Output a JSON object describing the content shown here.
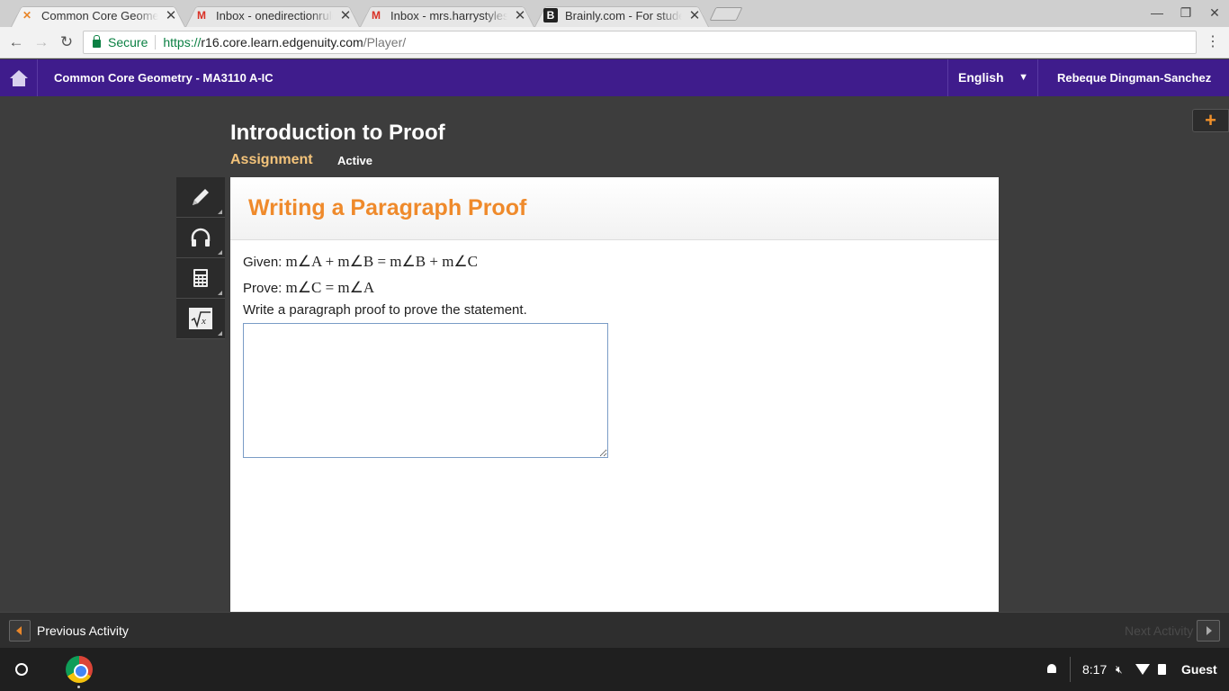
{
  "browser": {
    "tabs": [
      {
        "title": "Common Core Geometry",
        "favicon": "edgenuity-x-icon",
        "active": true
      },
      {
        "title": "Inbox - onedirectionrules",
        "favicon": "gmail-icon",
        "active": false
      },
      {
        "title": "Inbox - mrs.harrystyles1",
        "favicon": "gmail-icon",
        "active": false
      },
      {
        "title": "Brainly.com - For students",
        "favicon": "brainly-icon",
        "active": false
      }
    ],
    "close_glyph": "✕",
    "secure_label": "Secure",
    "url_scheme": "https://",
    "url_host": "r16.core.learn.edgenuity.com",
    "url_path": "/Player/"
  },
  "header": {
    "course": "Common Core Geometry - MA3110 A-IC",
    "language": "English",
    "user": "Rebeque Dingman-Sanchez"
  },
  "lesson": {
    "title": "Introduction to Proof",
    "type": "Assignment",
    "status": "Active"
  },
  "activity": {
    "title": "Writing a Paragraph Proof",
    "given_label": "Given:",
    "given_math": "m∠A + m∠B = m∠B + m∠C",
    "prove_label": "Prove:",
    "prove_math": "m∠C = m∠A",
    "instruction": "Write a paragraph proof to prove the statement.",
    "answer_value": ""
  },
  "footer": {
    "previous": "Previous Activity",
    "next": "Next Activity"
  },
  "system": {
    "time": "8:17",
    "user": "Guest"
  },
  "colors": {
    "header_purple": "#3f1c8c",
    "accent_orange": "#ef8a2b",
    "assignment_gold": "#f3c37a",
    "secure_green": "#0b8043"
  }
}
